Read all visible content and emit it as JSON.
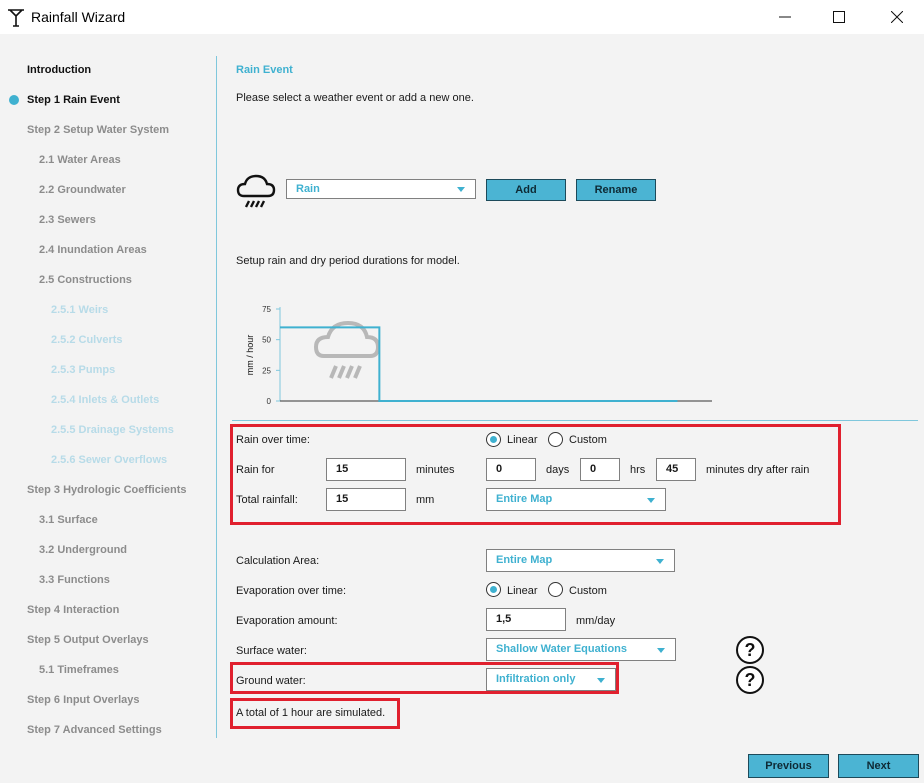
{
  "window": {
    "title": "Rainfall Wizard"
  },
  "sidebar": {
    "items": [
      {
        "label": "Introduction",
        "state": "active"
      },
      {
        "label": "Step 1 Rain Event",
        "state": "current"
      },
      {
        "label": "Step 2 Setup Water System",
        "state": "normal"
      },
      {
        "label": "2.1 Water Areas",
        "state": "normal"
      },
      {
        "label": "2.2 Groundwater",
        "state": "normal"
      },
      {
        "label": "2.3 Sewers",
        "state": "normal"
      },
      {
        "label": "2.4 Inundation Areas",
        "state": "normal"
      },
      {
        "label": "2.5 Constructions",
        "state": "normal"
      },
      {
        "label": "2.5.1 Weirs",
        "state": "disabled"
      },
      {
        "label": "2.5.2 Culverts",
        "state": "disabled"
      },
      {
        "label": "2.5.3 Pumps",
        "state": "disabled"
      },
      {
        "label": "2.5.4 Inlets & Outlets",
        "state": "disabled"
      },
      {
        "label": "2.5.5 Drainage Systems",
        "state": "disabled"
      },
      {
        "label": "2.5.6 Sewer Overflows",
        "state": "disabled"
      },
      {
        "label": "Step 3 Hydrologic Coefficients",
        "state": "normal"
      },
      {
        "label": "3.1 Surface",
        "state": "normal"
      },
      {
        "label": "3.2 Underground",
        "state": "normal"
      },
      {
        "label": "3.3 Functions",
        "state": "normal"
      },
      {
        "label": "Step 4 Interaction",
        "state": "normal"
      },
      {
        "label": "Step 5 Output Overlays",
        "state": "normal"
      },
      {
        "label": "5.1 Timeframes",
        "state": "normal"
      },
      {
        "label": "Step 6 Input Overlays",
        "state": "normal"
      },
      {
        "label": "Step 7 Advanced Settings",
        "state": "normal"
      }
    ]
  },
  "main": {
    "section_title": "Rain Event",
    "intro": "Please select a weather event or add a new one.",
    "event_select": "Rain",
    "add_label": "Add",
    "rename_label": "Rename",
    "setup_text": "Setup rain and dry period durations for model.",
    "rain_over_time": {
      "label": "Rain over time:",
      "linear": "Linear",
      "custom": "Custom",
      "selected": "Linear"
    },
    "rain_for": {
      "label": "Rain for",
      "minutes_value": "15",
      "minutes_unit": "minutes",
      "days_value": "0",
      "days_unit": "days",
      "hrs_value": "0",
      "hrs_unit": "hrs",
      "dry_value": "45",
      "dry_unit": "minutes dry after rain"
    },
    "total_rainfall": {
      "label": "Total rainfall:",
      "value": "15",
      "unit": "mm",
      "area": "Entire Map"
    },
    "calculation_area": {
      "label": "Calculation Area:",
      "value": "Entire Map"
    },
    "evaporation_over_time": {
      "label": "Evaporation over time:",
      "linear": "Linear",
      "custom": "Custom",
      "selected": "Linear"
    },
    "evaporation_amount": {
      "label": "Evaporation amount:",
      "value": "1,5",
      "unit": "mm/day"
    },
    "surface_water": {
      "label": "Surface water:",
      "value": "Shallow Water Equations"
    },
    "ground_water": {
      "label": "Ground water:",
      "value": "Infiltration only"
    },
    "summary": "A total of 1 hour are simulated.",
    "help_glyph": "?"
  },
  "chart_data": {
    "type": "area",
    "ylabel": "mm / hour",
    "yticks": [
      "0",
      "25",
      "50",
      "75"
    ],
    "ylim": [
      0,
      75
    ],
    "x": [
      0,
      15,
      15,
      60
    ],
    "values": [
      60,
      60,
      0,
      0
    ],
    "series_color": "#3fb1d0"
  },
  "footer": {
    "previous_label": "Previous",
    "next_label": "Next"
  },
  "colors": {
    "accent": "#3fb1d0",
    "highlight": "#e0202e"
  }
}
